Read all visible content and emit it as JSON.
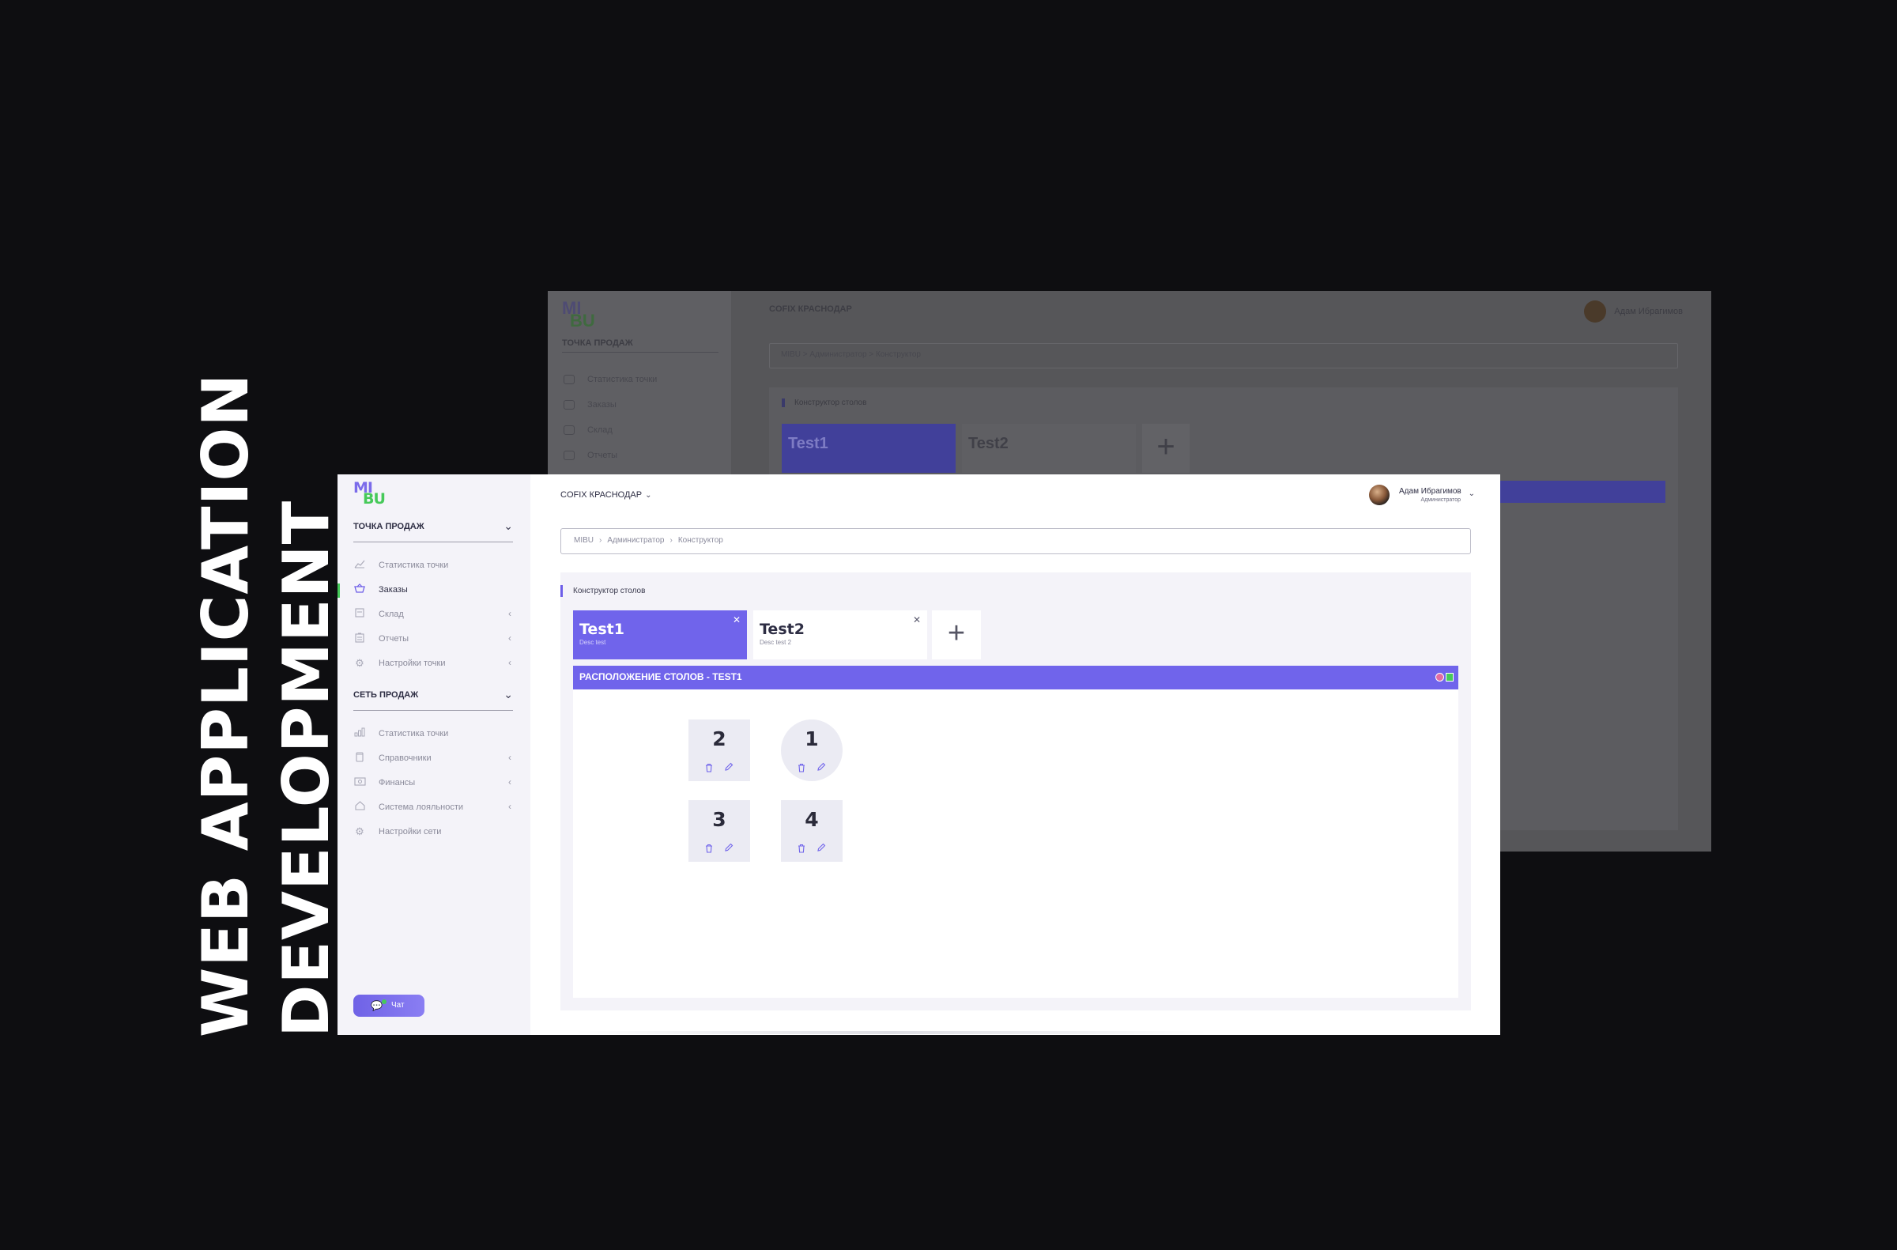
{
  "headline": {
    "line1": "WEB APPLICATION",
    "line2": "DEVELOPMENT"
  },
  "background_window": {
    "logo": {
      "part1": "MI",
      "part2": "BU"
    },
    "store": "COFIX КРАСНОДАР",
    "section": "ТОЧКА ПРОДАЖ",
    "items": [
      "Статистика точки",
      "Заказы",
      "Склад",
      "Отчеты"
    ],
    "breadcrumb": "MIBU  >  Администратор  >  Конструктор",
    "content_title": "Конструктор столов",
    "tab1": "Test1",
    "tab2": "Test2",
    "user": "Адам Ибрагимов"
  },
  "app": {
    "logo": {
      "part1": "MI",
      "part2": "BU"
    },
    "store": {
      "label": "COFIX КРАСНОДАР",
      "icon": "chevron-down-icon"
    },
    "user": {
      "name": "Адам Ибрагимов",
      "role": "Администратор"
    },
    "sidebar": {
      "sections": [
        {
          "title": "ТОЧКА ПРОДАЖ",
          "items": [
            {
              "label": "Статистика точки",
              "icon": "chart-line-icon",
              "active": false,
              "submenu": false
            },
            {
              "label": "Заказы",
              "icon": "basket-icon",
              "active": true,
              "submenu": false
            },
            {
              "label": "Склад",
              "icon": "box-icon",
              "active": false,
              "submenu": true
            },
            {
              "label": "Отчеты",
              "icon": "clipboard-icon",
              "active": false,
              "submenu": true
            },
            {
              "label": "Настройки точки",
              "icon": "gear-icon",
              "active": false,
              "submenu": true
            }
          ]
        },
        {
          "title": "СЕТЬ ПРОДАЖ",
          "items": [
            {
              "label": "Статистика точки",
              "icon": "bar-chart-icon",
              "active": false,
              "submenu": false
            },
            {
              "label": "Справочники",
              "icon": "book-icon",
              "active": false,
              "submenu": true
            },
            {
              "label": "Финансы",
              "icon": "money-icon",
              "active": false,
              "submenu": true
            },
            {
              "label": "Система лояльности",
              "icon": "home-icon",
              "active": false,
              "submenu": true
            },
            {
              "label": "Настройки сети",
              "icon": "gear-icon",
              "active": false,
              "submenu": false
            }
          ]
        }
      ],
      "chat_label": "Чат"
    },
    "breadcrumb": [
      "MIBU",
      "Администратор",
      "Конструктор"
    ],
    "content_title": "Конструктор столов",
    "tabs": [
      {
        "name": "Test1",
        "desc": "Desc test",
        "selected": true
      },
      {
        "name": "Test2",
        "desc": "Desc test 2",
        "selected": false
      }
    ],
    "add_tab_label": "+",
    "layout_title": "РАСПОЛОЖЕНИЕ СТОЛОВ - TEST1",
    "tables": [
      {
        "number": "2",
        "shape": "square"
      },
      {
        "number": "1",
        "shape": "round"
      },
      {
        "number": "3",
        "shape": "square"
      },
      {
        "number": "4",
        "shape": "square"
      }
    ]
  },
  "colors": {
    "accent": "#7064eb",
    "green": "#46c95a",
    "page_background": "#0e0e11",
    "sidebar_background": "#f4f3f9"
  }
}
